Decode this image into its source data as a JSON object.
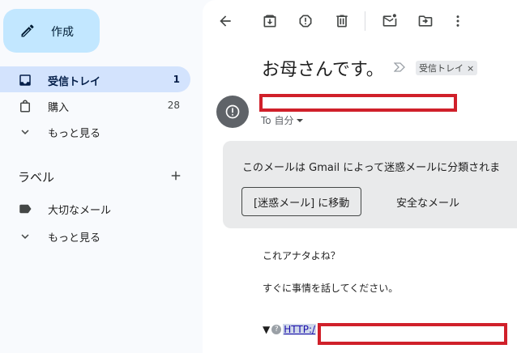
{
  "sidebar": {
    "compose_label": "作成",
    "items": [
      {
        "label": "受信トレイ",
        "count": "1"
      },
      {
        "label": "購入",
        "count": "28"
      },
      {
        "label": "もっと見る"
      }
    ],
    "labels_heading": "ラベル",
    "label_items": [
      {
        "label": "大切なメール"
      },
      {
        "label": "もっと見る"
      }
    ]
  },
  "toolbar": {
    "icons": [
      "back-arrow-icon",
      "archive-icon",
      "report-spam-icon",
      "delete-icon",
      "mark-unread-icon",
      "move-to-icon",
      "more-vert-icon"
    ]
  },
  "email": {
    "subject": "お母さんです。",
    "inbox_chip": "受信トレイ",
    "chip_close": "×",
    "to_line": "To 自分",
    "spam_notice": "このメールは Gmail によって迷惑メールに分類されま",
    "move_button": "[迷惑メール] に移動",
    "safe_button": "安全なメール",
    "body_lines": [
      "これアナタよね？",
      "すぐに事情を話してください。"
    ],
    "link_text": "HTTP:/"
  },
  "colors": {
    "compose_bg": "#c2e7ff",
    "active_nav": "#d3e3fd",
    "redaction": "#d0202a",
    "link": "#1a0dab"
  }
}
